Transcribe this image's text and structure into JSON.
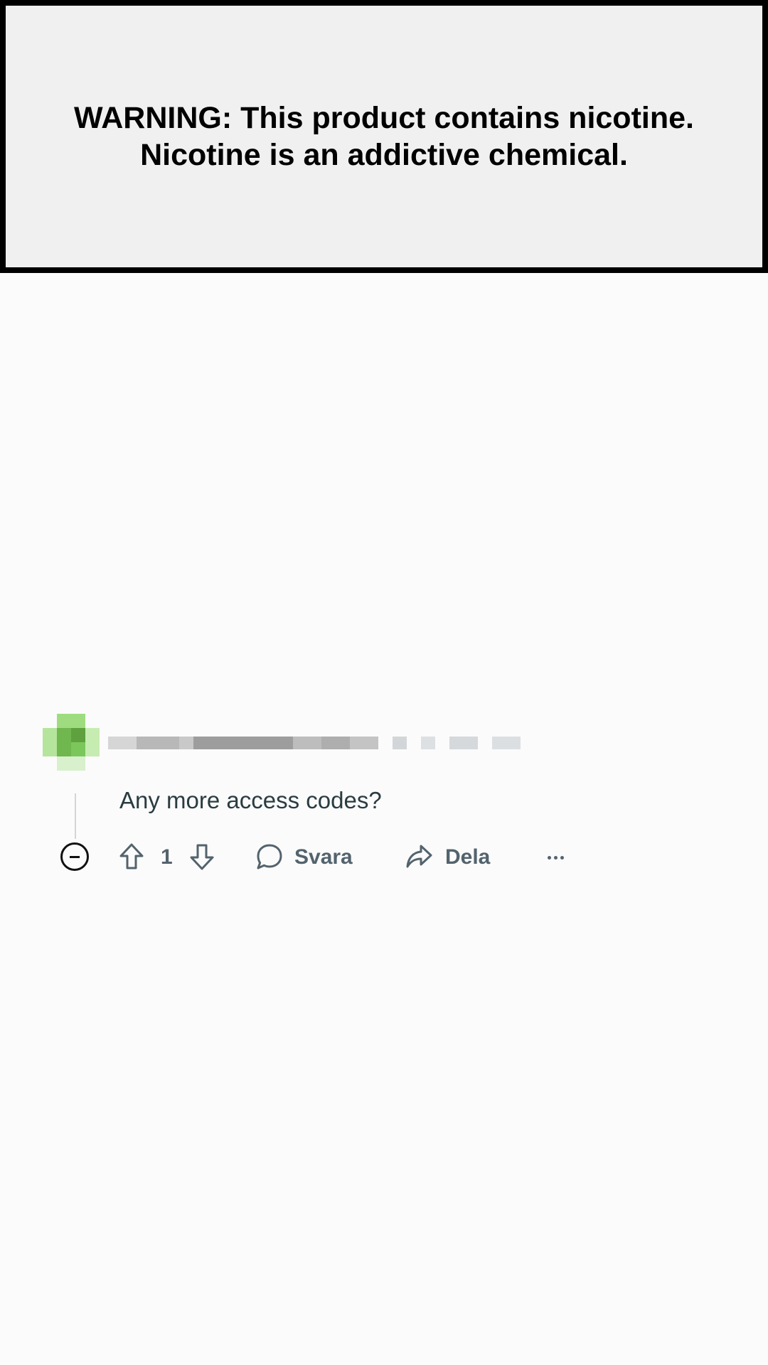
{
  "warning": {
    "line1": "WARNING: This product contains nicotine.",
    "line2": "Nicotine is an addictive chemical."
  },
  "comment": {
    "body": "Any more access codes?",
    "votes": "1",
    "reply_label": "Svara",
    "share_label": "Dela"
  },
  "colors": {
    "action_text": "#53636d",
    "body_text": "#2a3c42",
    "warning_border": "#000000",
    "avatar_green": "#7ccc5a"
  },
  "icons": {
    "collapse": "minus-circle-icon",
    "upvote": "arrow-up-icon",
    "downvote": "arrow-down-icon",
    "reply": "speech-bubble-icon",
    "share": "share-arrow-icon",
    "more": "ellipsis-icon"
  }
}
